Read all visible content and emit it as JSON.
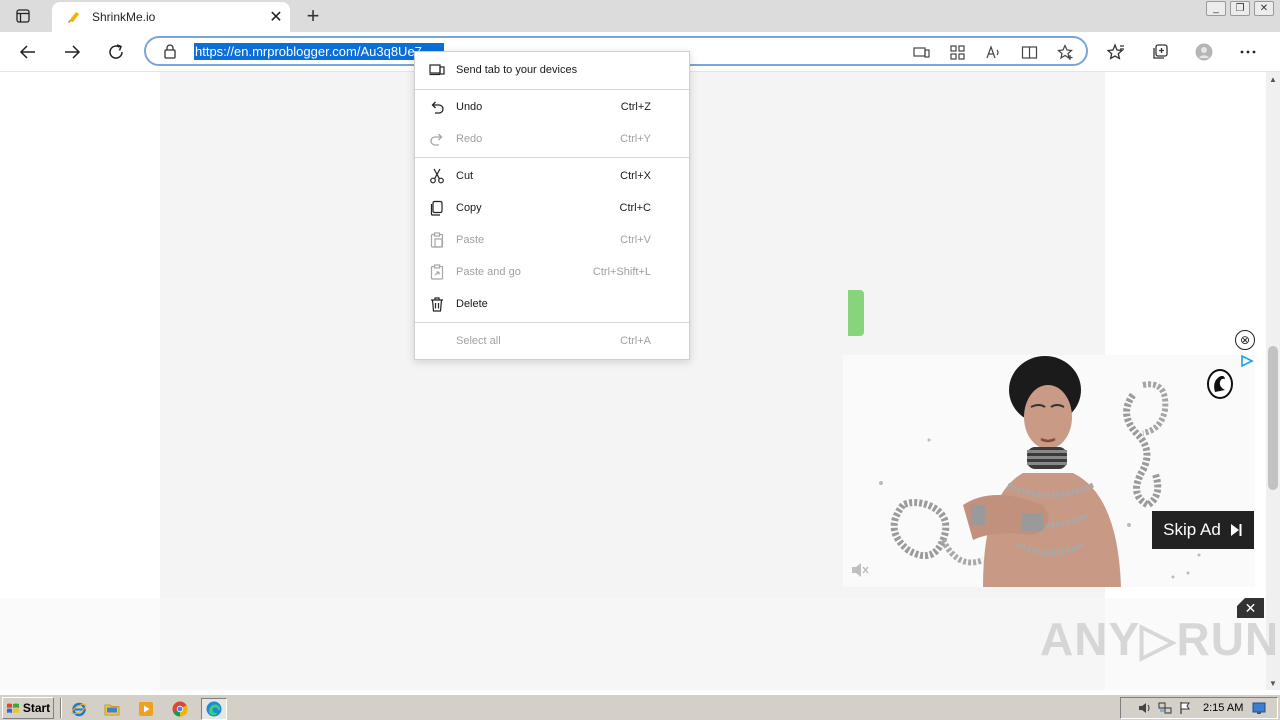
{
  "browser": {
    "tab": {
      "title": "ShrinkMe.io",
      "close_label": "✕"
    },
    "new_tab_label": "+",
    "window_buttons": [
      "_",
      "❐",
      "✕"
    ],
    "address": {
      "url": "https://en.mrproblogger.com/Au3q8Ue7"
    }
  },
  "context_menu": {
    "items": [
      {
        "label": "Send tab to your devices",
        "shortcut": "",
        "icon": "send-tab-icon",
        "enabled": true
      },
      {
        "label": "Undo",
        "shortcut": "Ctrl+Z",
        "icon": "undo-icon",
        "enabled": true
      },
      {
        "label": "Redo",
        "shortcut": "Ctrl+Y",
        "icon": "redo-icon",
        "enabled": false
      },
      {
        "label": "Cut",
        "shortcut": "Ctrl+X",
        "icon": "cut-icon",
        "enabled": true
      },
      {
        "label": "Copy",
        "shortcut": "Ctrl+C",
        "icon": "copy-icon",
        "enabled": true
      },
      {
        "label": "Paste",
        "shortcut": "Ctrl+V",
        "icon": "paste-icon",
        "enabled": false
      },
      {
        "label": "Paste and go",
        "shortcut": "Ctrl+Shift+L",
        "icon": "paste-go-icon",
        "enabled": false
      },
      {
        "label": "Delete",
        "shortcut": "",
        "icon": "delete-icon",
        "enabled": true
      },
      {
        "label": "Select all",
        "shortcut": "Ctrl+A",
        "icon": "",
        "enabled": false
      }
    ]
  },
  "ad": {
    "skip_label": "Skip Ad",
    "close_label": "✕",
    "dismiss_label": "⊗"
  },
  "watermark": "ANY▷RUN",
  "taskbar": {
    "start_label": "Start",
    "clock": "2:15 AM"
  },
  "colors": {
    "selection": "#0b6ed9",
    "address_border": "#7aa5d8",
    "green_button": "#86d47c",
    "skip_bg": "#222222"
  }
}
